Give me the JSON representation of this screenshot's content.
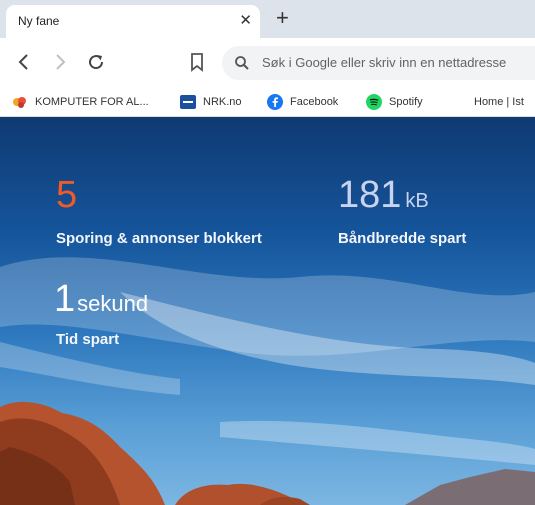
{
  "tab": {
    "title": "Ny fane",
    "close_glyph": "✕",
    "new_tab_glyph": "+"
  },
  "toolbar": {
    "icons": [
      "back-arrow-icon",
      "forward-arrow-icon",
      "reload-icon",
      "bookmark-icon"
    ],
    "omnibox_placeholder": "Søk i Google eller skriv inn en nettadresse"
  },
  "bookmarks": [
    {
      "label": "KOMPUTER FOR AL...",
      "icon": "komputer-favicon",
      "color": "#e94e3b"
    },
    {
      "label": "NRK.no",
      "icon": "nrk-favicon",
      "color": "#1d4f9f"
    },
    {
      "label": "Facebook",
      "icon": "facebook-icon",
      "color": "#1877f2"
    },
    {
      "label": "Spotify",
      "icon": "spotify-icon",
      "color": "#1ed760"
    },
    {
      "label": "Home | Ist",
      "icon": "",
      "color": ""
    }
  ],
  "stats": {
    "trackers": {
      "value": "5",
      "label": "Sporing & annonser blokkert",
      "color": "#f05a28"
    },
    "bandwidth": {
      "value": "181",
      "unit": "kB",
      "label": "Båndbredde spart",
      "color": "#c9d3ee"
    },
    "time": {
      "value": "1",
      "unit": "sekund",
      "label": "Tid spart"
    }
  }
}
